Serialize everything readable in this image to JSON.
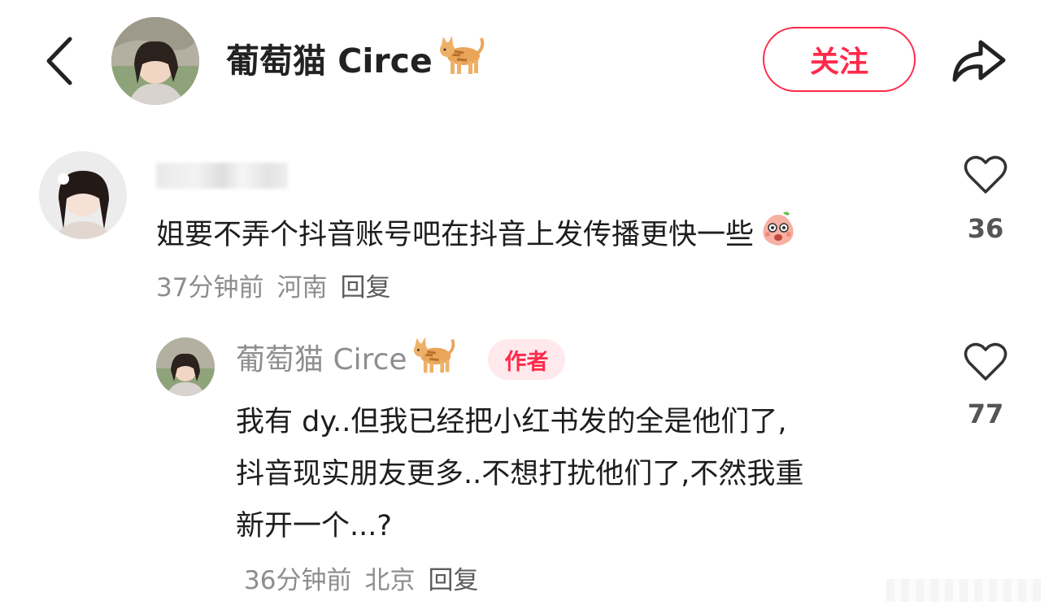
{
  "header": {
    "back_icon": "chevron-left-icon",
    "author_name": "葡萄猫 Circe",
    "author_emoji": "cat-emoji",
    "follow_label": "关注",
    "share_icon": "share-arrow-icon"
  },
  "comments": [
    {
      "text": "姐要不弄个抖音账号吧在抖音上发传播更快一些",
      "sticker": "peach-emoji",
      "time": "37分钟前",
      "location": "河南",
      "reply_label": "回复",
      "likes": "36"
    }
  ],
  "reply": {
    "author_name": "葡萄猫 Circe",
    "badge": "作者",
    "lines": [
      "我有 dy..但我已经把小红书发的全是他们了,",
      "抖音现实朋友更多..不想打扰他们了,不然我重",
      "新开一个...?"
    ],
    "time": "36分钟前",
    "location": "北京",
    "reply_label": "回复",
    "likes": "77"
  },
  "colors": {
    "accent": "#ff2a4b",
    "badge_bg": "#ffe9ec",
    "meta_text": "#8d8d8d"
  }
}
